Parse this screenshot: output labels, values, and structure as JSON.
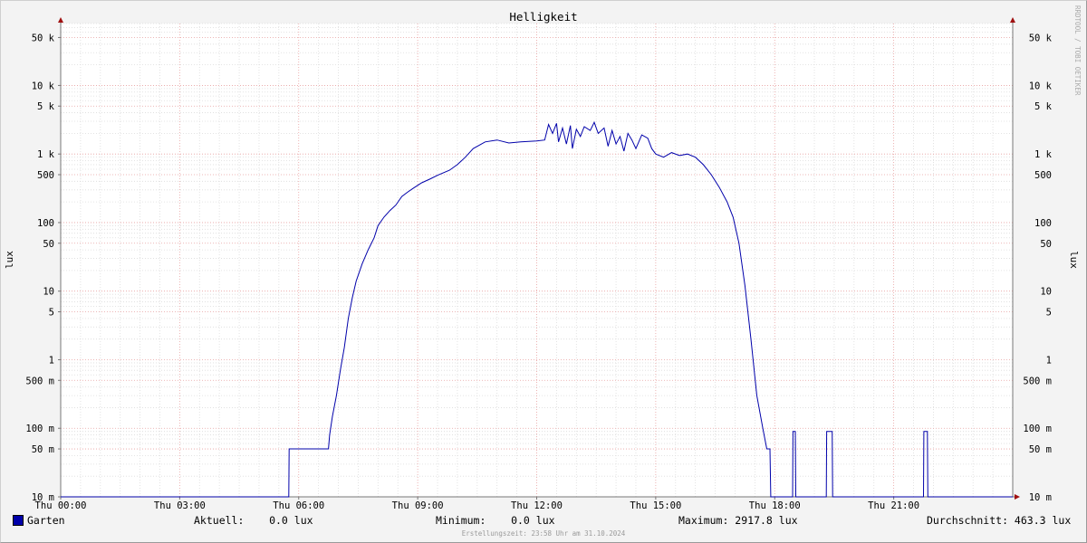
{
  "chart_data": {
    "type": "line",
    "title": "Helligkeit",
    "ylabel": "lux",
    "y_scale": "log",
    "ylim": [
      0.01,
      80000
    ],
    "y_ticks": [
      {
        "v": 0.01,
        "label": "10 m"
      },
      {
        "v": 0.05,
        "label": "50 m"
      },
      {
        "v": 0.1,
        "label": "100 m"
      },
      {
        "v": 0.5,
        "label": "500 m"
      },
      {
        "v": 1,
        "label": "1"
      },
      {
        "v": 5,
        "label": "5"
      },
      {
        "v": 10,
        "label": "10"
      },
      {
        "v": 50,
        "label": "50"
      },
      {
        "v": 100,
        "label": "100"
      },
      {
        "v": 500,
        "label": "500"
      },
      {
        "v": 1000,
        "label": "1 k"
      },
      {
        "v": 5000,
        "label": "5 k"
      },
      {
        "v": 10000,
        "label": "10 k"
      },
      {
        "v": 50000,
        "label": "50 k"
      }
    ],
    "x_ticks": [
      {
        "h": 0,
        "label": "Thu 00:00"
      },
      {
        "h": 3,
        "label": "Thu 03:00"
      },
      {
        "h": 6,
        "label": "Thu 06:00"
      },
      {
        "h": 9,
        "label": "Thu 09:00"
      },
      {
        "h": 12,
        "label": "Thu 12:00"
      },
      {
        "h": 15,
        "label": "Thu 15:00"
      },
      {
        "h": 18,
        "label": "Thu 18:00"
      },
      {
        "h": 21,
        "label": "Thu 21:00"
      }
    ],
    "xlim_hours": [
      0,
      24
    ],
    "grid": true,
    "series": [
      {
        "name": "Garten",
        "color": "#0000aa",
        "points": [
          [
            0,
            0.01
          ],
          [
            5.75,
            0.01
          ],
          [
            5.76,
            0.05
          ],
          [
            6.75,
            0.05
          ],
          [
            6.78,
            0.08
          ],
          [
            6.85,
            0.15
          ],
          [
            6.95,
            0.3
          ],
          [
            7.05,
            0.7
          ],
          [
            7.15,
            1.5
          ],
          [
            7.25,
            4
          ],
          [
            7.35,
            8
          ],
          [
            7.45,
            14
          ],
          [
            7.6,
            25
          ],
          [
            7.75,
            40
          ],
          [
            7.9,
            60
          ],
          [
            8.0,
            90
          ],
          [
            8.15,
            120
          ],
          [
            8.3,
            150
          ],
          [
            8.45,
            180
          ],
          [
            8.6,
            240
          ],
          [
            8.75,
            280
          ],
          [
            8.9,
            320
          ],
          [
            9.1,
            380
          ],
          [
            9.3,
            430
          ],
          [
            9.5,
            490
          ],
          [
            9.8,
            580
          ],
          [
            10.0,
            700
          ],
          [
            10.2,
            900
          ],
          [
            10.4,
            1200
          ],
          [
            10.7,
            1500
          ],
          [
            11.0,
            1600
          ],
          [
            11.3,
            1450
          ],
          [
            11.6,
            1500
          ],
          [
            12.0,
            1550
          ],
          [
            12.2,
            1600
          ],
          [
            12.3,
            2700
          ],
          [
            12.4,
            2000
          ],
          [
            12.5,
            2800
          ],
          [
            12.55,
            1500
          ],
          [
            12.65,
            2400
          ],
          [
            12.75,
            1400
          ],
          [
            12.85,
            2600
          ],
          [
            12.9,
            1200
          ],
          [
            13.0,
            2300
          ],
          [
            13.1,
            1800
          ],
          [
            13.2,
            2500
          ],
          [
            13.35,
            2200
          ],
          [
            13.45,
            2900
          ],
          [
            13.55,
            2000
          ],
          [
            13.7,
            2400
          ],
          [
            13.8,
            1300
          ],
          [
            13.9,
            2200
          ],
          [
            14.0,
            1400
          ],
          [
            14.1,
            1800
          ],
          [
            14.2,
            1100
          ],
          [
            14.3,
            2000
          ],
          [
            14.4,
            1600
          ],
          [
            14.5,
            1200
          ],
          [
            14.65,
            1900
          ],
          [
            14.8,
            1700
          ],
          [
            14.9,
            1200
          ],
          [
            15.0,
            1000
          ],
          [
            15.2,
            900
          ],
          [
            15.4,
            1050
          ],
          [
            15.6,
            950
          ],
          [
            15.8,
            1000
          ],
          [
            16.0,
            900
          ],
          [
            16.2,
            700
          ],
          [
            16.4,
            500
          ],
          [
            16.6,
            330
          ],
          [
            16.8,
            200
          ],
          [
            16.95,
            120
          ],
          [
            17.1,
            50
          ],
          [
            17.25,
            12
          ],
          [
            17.4,
            2
          ],
          [
            17.55,
            0.3
          ],
          [
            17.7,
            0.1
          ],
          [
            17.8,
            0.05
          ],
          [
            17.88,
            0.05
          ],
          [
            17.9,
            0.01
          ],
          [
            18.45,
            0.01
          ],
          [
            18.46,
            0.09
          ],
          [
            18.52,
            0.09
          ],
          [
            18.53,
            0.01
          ],
          [
            19.3,
            0.01
          ],
          [
            19.31,
            0.09
          ],
          [
            19.45,
            0.09
          ],
          [
            19.46,
            0.01
          ],
          [
            21.75,
            0.01
          ],
          [
            21.76,
            0.09
          ],
          [
            21.85,
            0.09
          ],
          [
            21.86,
            0.01
          ],
          [
            24,
            0.01
          ]
        ]
      }
    ]
  },
  "legend": {
    "series_name": "Garten",
    "aktuell": "Aktuell:    0.0 lux",
    "minimum": "Minimum:    0.0 lux",
    "maximum": "Maximum: 2917.8 lux",
    "durchschnitt": "Durchschnitt: 463.3 lux"
  },
  "footer": "Erstellungszeit: 23:58 Uhr am 31.10.2024",
  "watermark": "RRDTOOL / TOBI OETIKER"
}
